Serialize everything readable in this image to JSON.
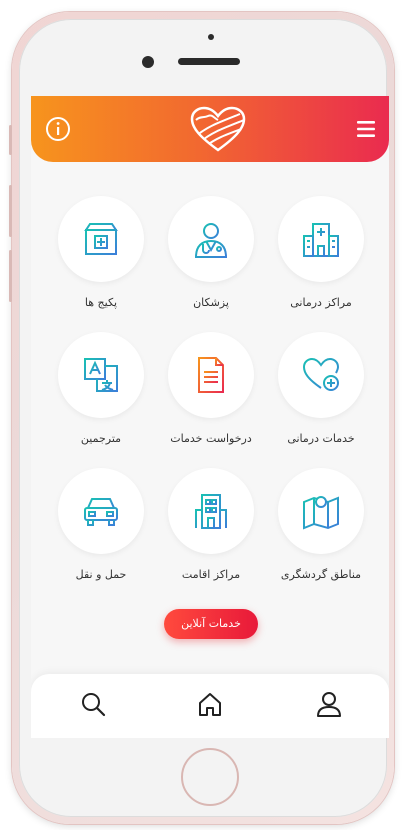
{
  "colors": {
    "header_gradient": [
      "#f7941d",
      "#ea2b4f"
    ],
    "icon_gradient": [
      "#19c0b4",
      "#3b7fd9"
    ],
    "accent_button": "#e8193a"
  },
  "header": {
    "info_icon": "info-icon",
    "logo": "heart-logo",
    "menu_icon": "hamburger-menu-icon"
  },
  "tiles": [
    {
      "label": "مراکز درمانی",
      "icon": "hospital-icon"
    },
    {
      "label": "پزشکان",
      "icon": "doctor-icon"
    },
    {
      "label": "پکیج ها",
      "icon": "package-box-icon"
    },
    {
      "label": "خدمات درمانی",
      "icon": "heart-plus-icon"
    },
    {
      "label": "درخواست خدمات",
      "icon": "document-icon"
    },
    {
      "label": "مترجمین",
      "icon": "translate-icon"
    },
    {
      "label": "مناطق گردشگری",
      "icon": "map-pin-icon"
    },
    {
      "label": "مراکز اقامت",
      "icon": "building-icon"
    },
    {
      "label": "حمل و نقل",
      "icon": "car-icon"
    }
  ],
  "online_button": {
    "label": "خدمات آنلاین"
  },
  "bottom_nav": [
    {
      "icon": "search-icon"
    },
    {
      "icon": "home-icon"
    },
    {
      "icon": "user-icon"
    }
  ]
}
